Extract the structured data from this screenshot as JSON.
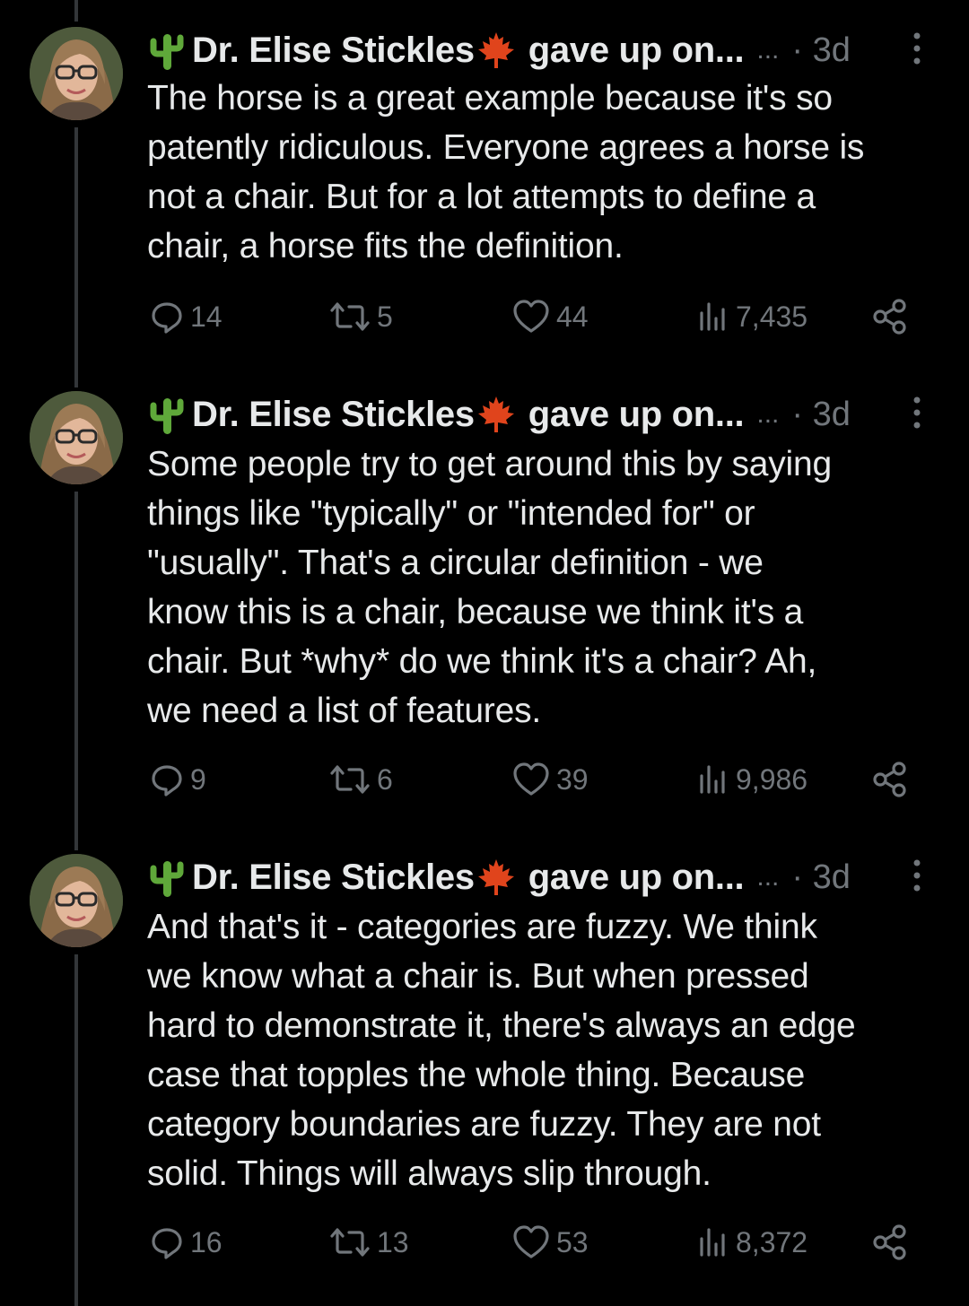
{
  "tweets": [
    {
      "author": "Dr. Elise Stickles",
      "handle_truncated": "gave up on...",
      "ellipsis": "...",
      "time": "· 3d",
      "lines": [
        "The horse is a great example because it's so",
        "patently ridiculous. Everyone agrees a horse is",
        "not a chair. But for a lot attempts to define a",
        "chair, a horse fits the definition."
      ],
      "replies": "14",
      "reposts": "5",
      "likes": "44",
      "views": "7,435"
    },
    {
      "author": "Dr. Elise Stickles",
      "handle_truncated": "gave up on...",
      "ellipsis": "...",
      "time": "· 3d",
      "lines": [
        "Some people try to get around this by saying",
        "things like \"typically\" or \"intended for\" or",
        "\"usually\". That's a circular definition - we",
        "know this is a chair, because we think it's a",
        "chair. But *why* do we think it's a chair? Ah,",
        "we need a list of features."
      ],
      "replies": "9",
      "reposts": "6",
      "likes": "39",
      "views": "9,986"
    },
    {
      "author": "Dr. Elise Stickles",
      "handle_truncated": "gave up on...",
      "ellipsis": "...",
      "time": "· 3d",
      "lines": [
        "And that's it - categories are fuzzy. We think",
        "we know what a chair is. But when pressed",
        "hard to demonstrate it, there's always an edge",
        "case that topples the whole thing. Because",
        "category boundaries are fuzzy. They are not",
        "solid. Things will always slip through."
      ],
      "replies": "16",
      "reposts": "13",
      "likes": "53",
      "views": "8,372"
    }
  ],
  "icons": {
    "name_prefix": "cactus-icon",
    "name_suffix": "maple-leaf-icon",
    "reply": "reply-icon",
    "repost": "repost-icon",
    "like": "heart-icon",
    "views": "views-icon",
    "share": "share-icon",
    "more": "more-vertical-icon"
  },
  "colors": {
    "background": "#000000",
    "text": "#e7e9ea",
    "muted": "#71767b",
    "thread_line": "#333639",
    "cactus": "#5fa83a",
    "maple": "#e0441c"
  }
}
